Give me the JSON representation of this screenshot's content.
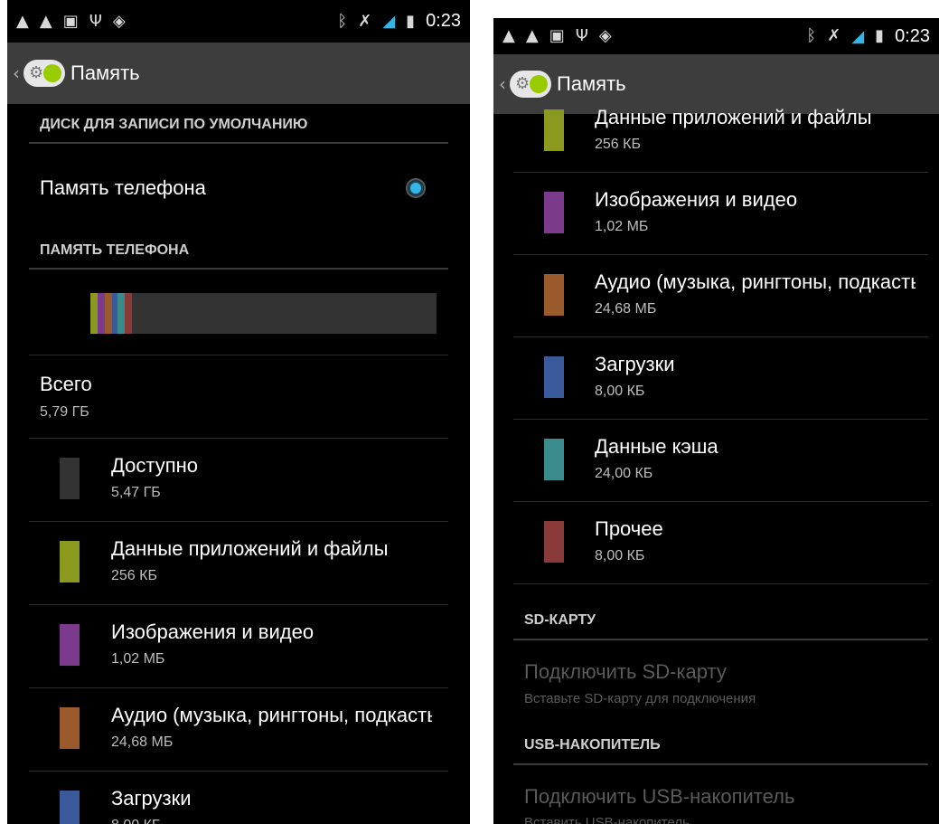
{
  "status_bar": {
    "time": "0:23",
    "left_icons": [
      "warning-icon",
      "warning-icon",
      "image-icon",
      "usb-icon",
      "wifi-icon"
    ],
    "right_icons": [
      "bluetooth-icon",
      "mute-icon",
      "signal-icon",
      "battery-icon"
    ]
  },
  "action_bar": {
    "title": "Память"
  },
  "default_disk": {
    "header": "ДИСК ДЛЯ ЗАПИСИ ПО УМОЛЧАНИЮ",
    "option_label": "Память телефона",
    "selected": true
  },
  "phone_memory": {
    "header": "ПАМЯТЬ ТЕЛЕФОНА",
    "usage_segments_pct": [
      {
        "color": "#8b9a1e",
        "pct": 2.1
      },
      {
        "color": "#7b3a8c",
        "pct": 2.1
      },
      {
        "color": "#9a5a2c",
        "pct": 2.1
      },
      {
        "color": "#3a5a9c",
        "pct": 1.6
      },
      {
        "color": "#3a8c8c",
        "pct": 2.1
      },
      {
        "color": "#8b3a3a",
        "pct": 2.1
      }
    ],
    "total_label": "Всего",
    "total_value": "5,79 ГБ",
    "items": [
      {
        "label": "Доступно",
        "value": "5,47 ГБ",
        "color": "#333333"
      },
      {
        "label": "Данные приложений и файлы",
        "value": "256 КБ",
        "color": "#8b9a1e"
      },
      {
        "label": "Изображения и видео",
        "value": "1,02 МБ",
        "color": "#7b3a8c"
      },
      {
        "label": "Аудио (музыка, рингтоны, подкасты)",
        "value": "24,68 МБ",
        "color": "#9a5a2c"
      },
      {
        "label": "Загрузки",
        "value": "8,00 КБ",
        "color": "#3a5a9c"
      },
      {
        "label": "Данные кэша",
        "value": "24,00 КБ",
        "color": "#3a8c8c"
      },
      {
        "label": "Прочее",
        "value": "8,00 КБ",
        "color": "#8b3a3a"
      }
    ]
  },
  "sd_card": {
    "header": "SD-КАРТУ",
    "action_title": "Подключить SD-карту",
    "action_sub": "Вставьте SD-карту для подключения"
  },
  "usb_storage": {
    "header": "USB-НАКОПИТЕЛЬ",
    "action_title": "Подключить USB-накопитель",
    "action_sub": "Вставить USB-накопитель"
  }
}
